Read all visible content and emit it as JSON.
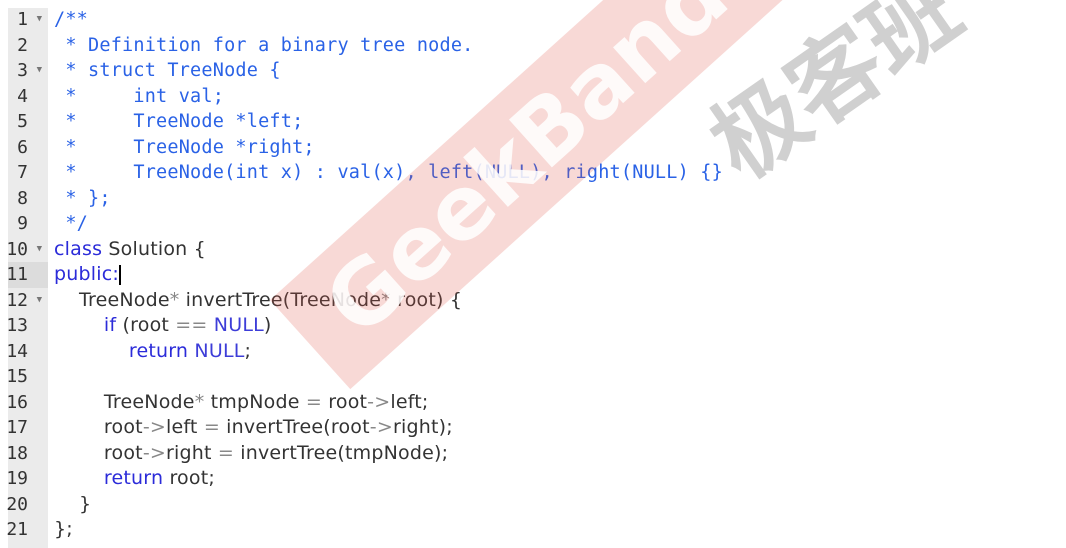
{
  "colors": {
    "comment": "#2a62e6",
    "keyword": "#2b2bd9",
    "constant": "#3d3dd8",
    "text": "#333333",
    "operator": "#888888"
  },
  "watermarks": {
    "red": "GeekBand",
    "grey": "极客班"
  },
  "active_line": 11,
  "lines": [
    {
      "n": "1",
      "fold": true,
      "tokens": [
        {
          "t": "/**",
          "c": "comment"
        }
      ]
    },
    {
      "n": "2",
      "tokens": [
        {
          "t": " * Definition for a binary tree node.",
          "c": "comment"
        }
      ]
    },
    {
      "n": "3",
      "fold": true,
      "tokens": [
        {
          "t": " * struct TreeNode {",
          "c": "comment"
        }
      ]
    },
    {
      "n": "4",
      "tokens": [
        {
          "t": " *     int val;",
          "c": "comment"
        }
      ]
    },
    {
      "n": "5",
      "tokens": [
        {
          "t": " *     TreeNode *left;",
          "c": "comment"
        }
      ]
    },
    {
      "n": "6",
      "tokens": [
        {
          "t": " *     TreeNode *right;",
          "c": "comment"
        }
      ]
    },
    {
      "n": "7",
      "tokens": [
        {
          "t": " *     TreeNode(int x) : val(x), left(NULL), right(NULL) {}",
          "c": "comment"
        }
      ]
    },
    {
      "n": "8",
      "tokens": [
        {
          "t": " * };",
          "c": "comment"
        }
      ]
    },
    {
      "n": "9",
      "tokens": [
        {
          "t": " */",
          "c": "comment"
        }
      ]
    },
    {
      "n": "10",
      "fold": true,
      "tokens": [
        {
          "t": "class",
          "c": "keyword"
        },
        {
          "t": " Solution {",
          "c": "text"
        }
      ]
    },
    {
      "n": "11",
      "tokens": [
        {
          "t": "public:",
          "c": "keyword"
        }
      ],
      "cursor": true
    },
    {
      "n": "12",
      "fold": true,
      "tokens": [
        {
          "t": "    TreeNode",
          "c": "text"
        },
        {
          "t": "*",
          "c": "operator"
        },
        {
          "t": " invertTree(TreeNode",
          "c": "text"
        },
        {
          "t": "*",
          "c": "operator"
        },
        {
          "t": " root) {",
          "c": "text"
        }
      ]
    },
    {
      "n": "13",
      "tokens": [
        {
          "t": "        ",
          "c": "text"
        },
        {
          "t": "if",
          "c": "keyword"
        },
        {
          "t": " (root ",
          "c": "text"
        },
        {
          "t": "==",
          "c": "operator"
        },
        {
          "t": " ",
          "c": "text"
        },
        {
          "t": "NULL",
          "c": "constant"
        },
        {
          "t": ")",
          "c": "text"
        }
      ]
    },
    {
      "n": "14",
      "tokens": [
        {
          "t": "            ",
          "c": "text"
        },
        {
          "t": "return",
          "c": "keyword"
        },
        {
          "t": " ",
          "c": "text"
        },
        {
          "t": "NULL",
          "c": "constant"
        },
        {
          "t": ";",
          "c": "text"
        }
      ]
    },
    {
      "n": "15",
      "tokens": []
    },
    {
      "n": "16",
      "tokens": [
        {
          "t": "        TreeNode",
          "c": "text"
        },
        {
          "t": "*",
          "c": "operator"
        },
        {
          "t": " tmpNode ",
          "c": "text"
        },
        {
          "t": "=",
          "c": "operator"
        },
        {
          "t": " root",
          "c": "text"
        },
        {
          "t": "->",
          "c": "operator"
        },
        {
          "t": "left;",
          "c": "text"
        }
      ]
    },
    {
      "n": "17",
      "tokens": [
        {
          "t": "        root",
          "c": "text"
        },
        {
          "t": "->",
          "c": "operator"
        },
        {
          "t": "left ",
          "c": "text"
        },
        {
          "t": "=",
          "c": "operator"
        },
        {
          "t": " invertTree(root",
          "c": "text"
        },
        {
          "t": "->",
          "c": "operator"
        },
        {
          "t": "right);",
          "c": "text"
        }
      ]
    },
    {
      "n": "18",
      "tokens": [
        {
          "t": "        root",
          "c": "text"
        },
        {
          "t": "->",
          "c": "operator"
        },
        {
          "t": "right ",
          "c": "text"
        },
        {
          "t": "=",
          "c": "operator"
        },
        {
          "t": " invertTree(tmpNode);",
          "c": "text"
        }
      ]
    },
    {
      "n": "19",
      "tokens": [
        {
          "t": "        ",
          "c": "text"
        },
        {
          "t": "return",
          "c": "keyword"
        },
        {
          "t": " root;",
          "c": "text"
        }
      ]
    },
    {
      "n": "20",
      "tokens": [
        {
          "t": "    }",
          "c": "text"
        }
      ]
    },
    {
      "n": "21",
      "tokens": [
        {
          "t": "};",
          "c": "text"
        }
      ]
    }
  ]
}
